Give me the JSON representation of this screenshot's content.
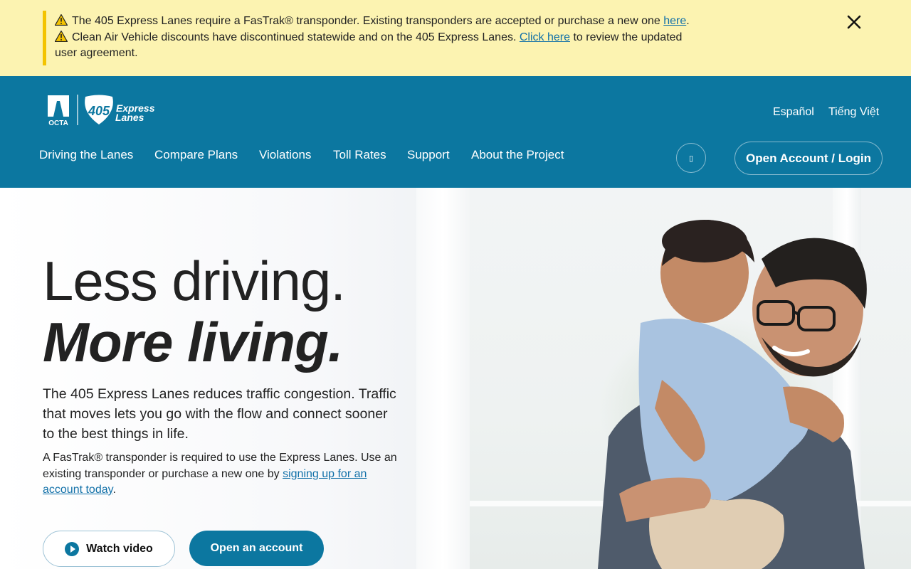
{
  "alert": {
    "line1": "The 405 Express Lanes require a FasTrak® transponder. Existing transponders are accepted or purchase a new one ",
    "line1_link": "here",
    "line1_end": ".",
    "line2": "Clean Air Vehicle discounts have discontinued statewide and on the 405 Express Lanes. ",
    "line2_link": "Click here",
    "line2_end": " to review the updated user agreement.",
    "close_icon": "close-icon",
    "warning_icon": "warning-icon"
  },
  "header": {
    "logo": {
      "octa": "OCTA",
      "shield_number": "405",
      "word1": "Express",
      "word2": "Lanes"
    },
    "languages": [
      "Español",
      "Tiếng Việt"
    ],
    "nav": [
      "Driving the Lanes",
      "Compare Plans",
      "Violations",
      "Toll Rates",
      "Support",
      "About the Project"
    ],
    "search_glyph": "▯",
    "login_label": "Open Account / Login"
  },
  "hero": {
    "title_line1": "Less driving.",
    "title_line2": "More living.",
    "lead": "The 405 Express Lanes reduces traffic congestion. Traffic that moves lets you go with the flow and connect sooner to the best things in life.",
    "note_text": "A FasTrak® transponder is required to use the Express Lanes. Use an existing transponder or purchase a new one by ",
    "note_link": "signing up for an account today",
    "note_end": ".",
    "watch_video_label": "Watch video",
    "open_account_label": "Open an account"
  },
  "colors": {
    "brand_blue": "#0c77a0",
    "alert_bg": "#fcf3b1",
    "alert_bar": "#f3c300",
    "link": "#1170a8"
  }
}
